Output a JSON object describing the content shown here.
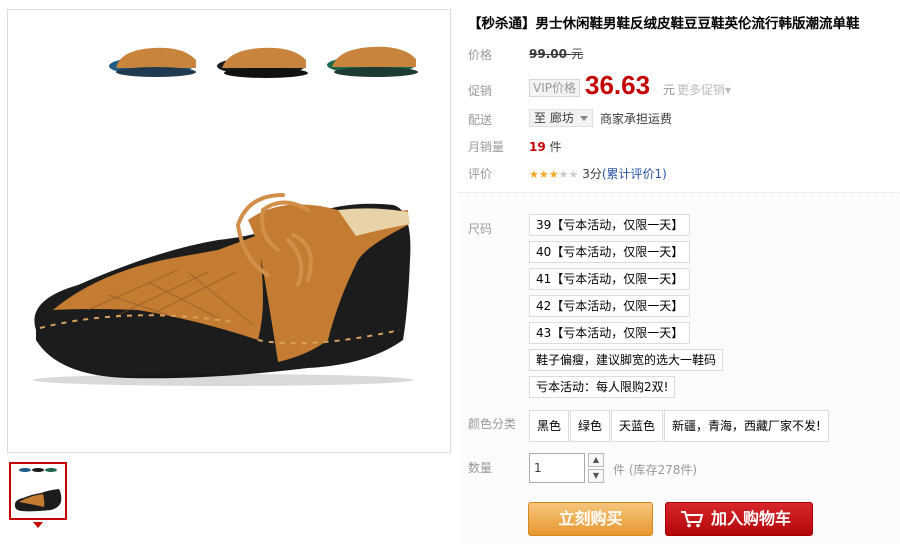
{
  "product": {
    "title": "【秒杀通】男士休闲鞋男鞋反绒皮鞋豆豆鞋英伦流行韩版潮流单鞋"
  },
  "gallery": {
    "main_image": "shoe-photo",
    "thumbnail": "shoe-thumbnail"
  },
  "price": {
    "label": "价格",
    "original": "99.00",
    "currency": "元"
  },
  "promo": {
    "label": "促销",
    "vip_tag": "VIP价格",
    "current": "36.63",
    "currency": "元",
    "more": "更多促销▾"
  },
  "shipping": {
    "label": "配送",
    "destination": "至 廊坊",
    "note": "商家承担运费"
  },
  "sales": {
    "label": "月销量",
    "count": "19",
    "unit": "件"
  },
  "review": {
    "label": "评价",
    "stars_on": 3,
    "stars_total": 5,
    "score": "3分",
    "link": "(累计评价1)"
  },
  "sizes": {
    "label": "尺码",
    "options": [
      "39【亏本活动，仅限一天】",
      "40【亏本活动，仅限一天】",
      "41【亏本活动，仅限一天】",
      "42【亏本活动，仅限一天】",
      "43【亏本活动，仅限一天】",
      "鞋子偏瘦，建议脚宽的选大一鞋码",
      "亏本活动：每人限购2双!"
    ]
  },
  "colors": {
    "label": "颜色分类",
    "options": [
      "黑色",
      "绿色",
      "天蓝色",
      "新疆，青海，西藏厂家不发!"
    ]
  },
  "quantity": {
    "label": "数量",
    "value": "1",
    "stock_prefix": "件",
    "stock": "(库存278件)"
  },
  "actions": {
    "buy_now": "立刻购买",
    "add_to_cart": "加入购物车"
  },
  "colors_hex": {
    "accent_red": "#c40000",
    "buy_orange": "#e7982e",
    "cart_red": "#b4060a"
  }
}
